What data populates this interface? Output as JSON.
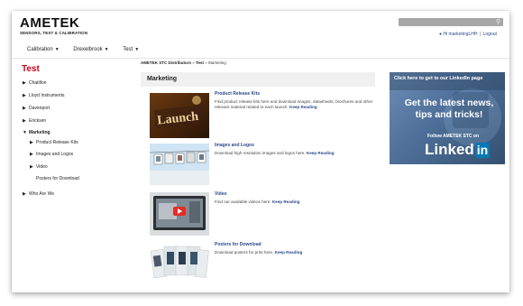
{
  "header": {
    "logo_main": "AMETEK",
    "logo_sub": "SENSORS, TEST & CALIBRATION",
    "search_placeholder": "",
    "user_label": "Hi marketingLHH",
    "logout_label": "Logout"
  },
  "nav": {
    "items": [
      {
        "label": "Calibration"
      },
      {
        "label": "Drexelbrook"
      },
      {
        "label": "Test"
      }
    ]
  },
  "breadcrumb": {
    "part1": "AMETEK STC Distributors",
    "sep": "»",
    "part2": "Test",
    "part3": "Marketing"
  },
  "sidebar": {
    "title": "Test",
    "items": [
      {
        "label": "Chatillon"
      },
      {
        "label": "Lloyd Instruments"
      },
      {
        "label": "Davenport"
      },
      {
        "label": "Ericksen"
      },
      {
        "label": "Marketing"
      },
      {
        "label": "Who Are We"
      }
    ],
    "subitems": [
      {
        "label": "Product Release Kits"
      },
      {
        "label": "Images and Logos"
      },
      {
        "label": "Video"
      },
      {
        "label": "Posters for Download"
      }
    ]
  },
  "main": {
    "panel_title": "Marketing",
    "read_more": "Keep Reading",
    "entries": [
      {
        "title": "Product Release Kits",
        "desc": "Find product release kits here and download images, datasheets, brochures and other relevant material related to each launch."
      },
      {
        "title": "Images and Logos",
        "desc": "Download high resolution images and logos here."
      },
      {
        "title": "Video",
        "desc": "Find our available videos here."
      },
      {
        "title": "Posters for Download",
        "desc": "Download posters for print here."
      }
    ]
  },
  "ad": {
    "top": "Click here to get to our LinkedIn page",
    "headline": "Get the latest news, tips and tricks!",
    "follow": "Follow AMETEK STC on",
    "brand_part1": "Linked",
    "brand_part2": "in"
  },
  "colors": {
    "accent_red": "#d0021b",
    "link_blue": "#2a4a8a",
    "linkedin_blue": "#0a77b5"
  }
}
